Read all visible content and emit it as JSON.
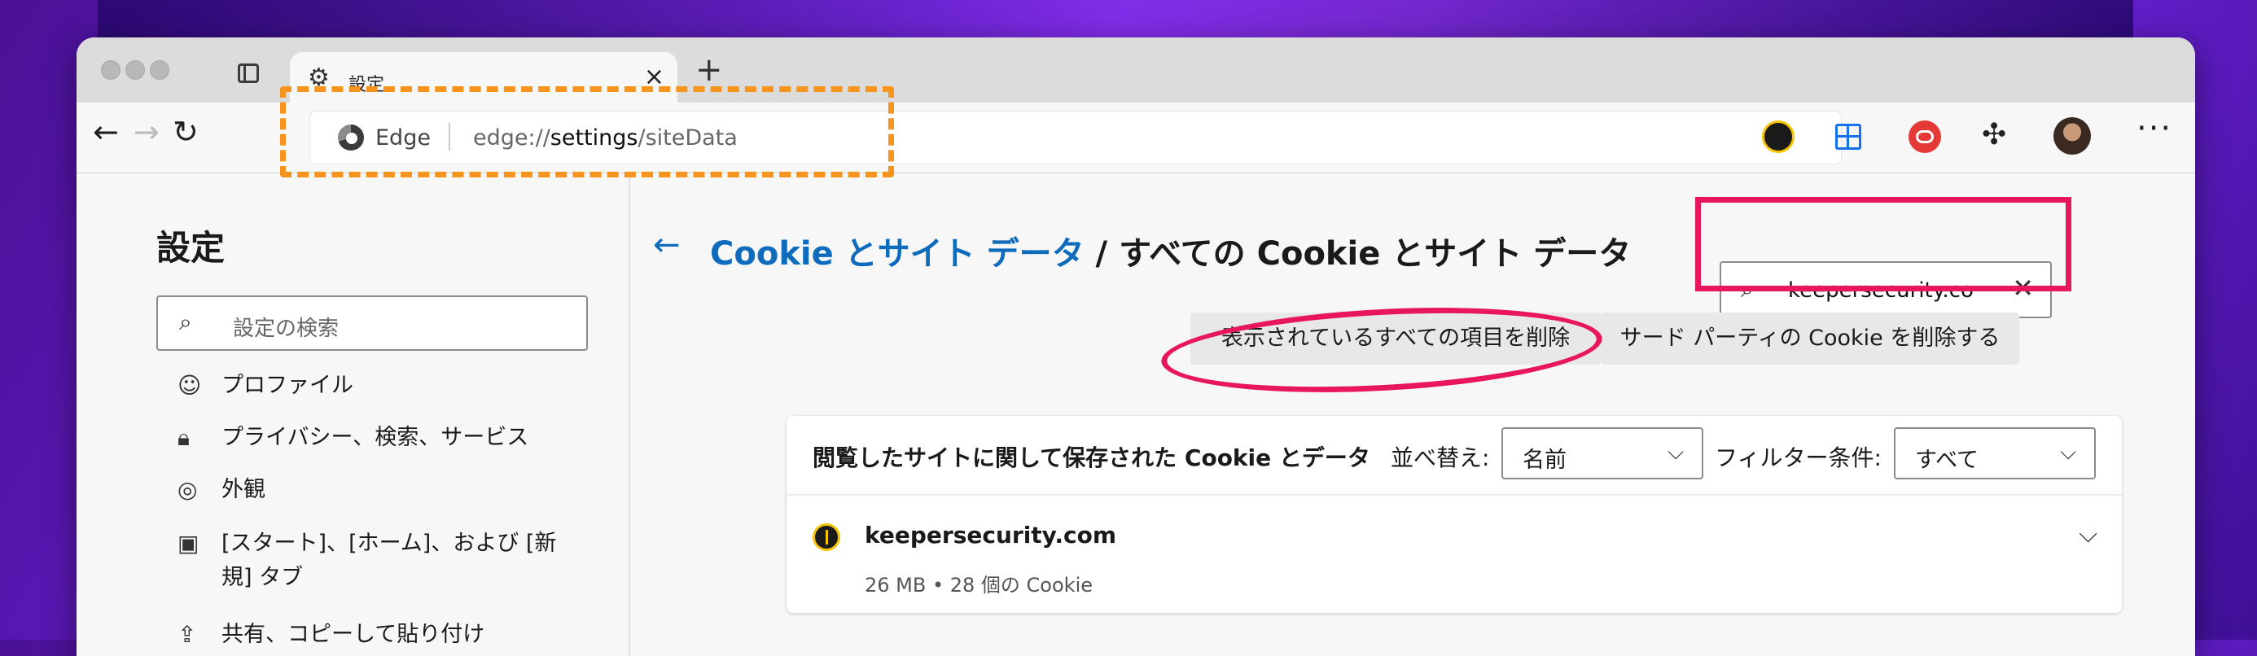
{
  "tab": {
    "title": "設定"
  },
  "omnibox": {
    "site_label": "Edge",
    "url_prefix": "edge://",
    "url_host": "settings",
    "url_path": "/siteData"
  },
  "sidebar": {
    "title": "設定",
    "search_placeholder": "設定の検索",
    "items": [
      {
        "label": "プロファイル",
        "icon": "profile-icon"
      },
      {
        "label": "プライバシー、検索、サービス",
        "icon": "lock-icon"
      },
      {
        "label": "外観",
        "icon": "palette-icon"
      },
      {
        "label": "[スタート]、[ホーム]、および [新",
        "label2": "規] タブ",
        "icon": "newtab-icon"
      },
      {
        "label": "共有、コピーして貼り付け",
        "icon": "share-icon"
      }
    ]
  },
  "main": {
    "breadcrumb_link": "Cookie とサイト データ",
    "breadcrumb_sep": " / ",
    "breadcrumb_current": "すべての Cookie とサイト データ",
    "search_value": "keepersecurity.co",
    "delete_all_button": "表示されているすべての項目を削除",
    "delete_third_party_button": "サード パーティの Cookie を削除する",
    "card": {
      "title": "閲覧したサイトに関して保存された Cookie とデータ",
      "sort_label": "並べ替え:",
      "sort_value": "名前",
      "filter_label": "フィルター条件:",
      "filter_value": "すべて",
      "site": {
        "name": "keepersecurity.com",
        "meta": "26 MB • 28 個の Cookie"
      }
    }
  },
  "colors": {
    "accent": "#0f6cbd",
    "highlight_orange": "#f7941d",
    "highlight_pink": "#e8175d"
  }
}
